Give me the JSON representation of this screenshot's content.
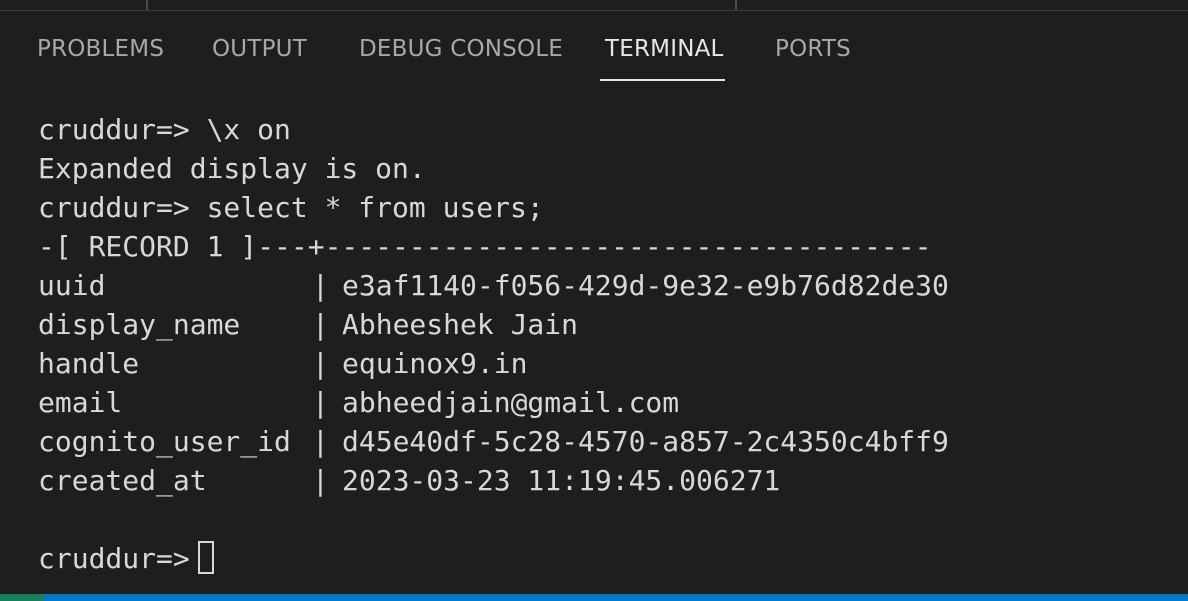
{
  "tabs": [
    {
      "label": "PROBLEMS"
    },
    {
      "label": "OUTPUT"
    },
    {
      "label": "DEBUG CONSOLE"
    },
    {
      "label": "TERMINAL",
      "active": true
    },
    {
      "label": "PORTS"
    }
  ],
  "terminal": {
    "lines": [
      "cruddur=> \\x on",
      "Expanded display is on.",
      "cruddur=> select * from users;",
      "-[ RECORD 1 ]---+------------------------------------"
    ],
    "record": [
      {
        "key": "uuid",
        "value": "e3af1140-f056-429d-9e32-e9b76d82de30"
      },
      {
        "key": "display_name",
        "value": "Abheeshek Jain"
      },
      {
        "key": "handle",
        "value": "equinox9.in"
      },
      {
        "key": "email",
        "value": "abheedjain@gmail.com"
      },
      {
        "key": "cognito_user_id",
        "value": "d45e40df-5c28-4570-a857-2c4350c4bff9"
      },
      {
        "key": "created_at",
        "value": "2023-03-23 11:19:45.006271"
      }
    ],
    "separator": "|",
    "prompt": "cruddur=>"
  },
  "colors": {
    "background": "#1e1e1e",
    "text": "#d8d8d8",
    "statusbar": "#007acc",
    "remote_indicator": "#16825d"
  }
}
